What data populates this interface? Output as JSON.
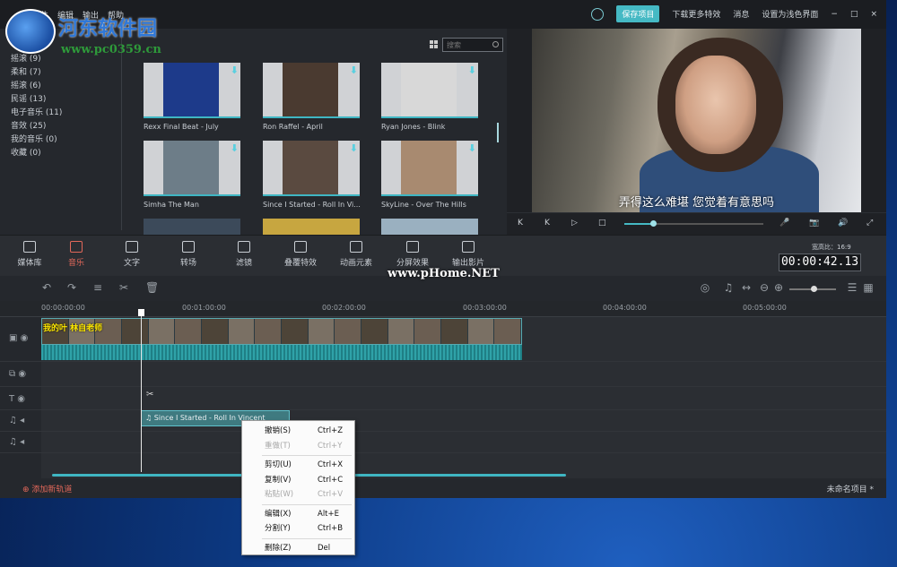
{
  "titlebar": {
    "menu": [
      "文件",
      "编辑",
      "输出",
      "帮助"
    ],
    "save_project": "保存项目",
    "download_effects": "下载更多特效",
    "messages": "消息",
    "set_light": "设置为浅色界面",
    "window_controls": [
      "−",
      "□",
      "×"
    ]
  },
  "library": {
    "categories": [
      "摇滚 (9)",
      "柔和 (7)",
      "摇滚 (6)",
      "民谣 (13)",
      "电子音乐 (11)",
      "音效 (25)",
      "我的音乐 (0)",
      "收藏 (0)"
    ],
    "search_placeholder": "搜索",
    "tiles": [
      {
        "caption": "Rexx Final Beat - July",
        "color": "#1d3a8a"
      },
      {
        "caption": "Ron Raffel - April",
        "color": "#4a3a30"
      },
      {
        "caption": "Ryan Jones - Blink",
        "color": "#d8d8d8"
      },
      {
        "caption": "Simha The Man",
        "color": "#6d7d88"
      },
      {
        "caption": "Since I Started - Roll In Vi...",
        "color": "#5a4a40"
      },
      {
        "caption": "SkyLine - Over The Hills",
        "color": "#a88a70"
      }
    ]
  },
  "preview": {
    "subtitle": "弄得这么难堪 您觉着有意思吗",
    "controls": [
      "K",
      "K",
      "▷",
      "□",
      "🎤",
      "📷",
      "🔊",
      "⤢"
    ]
  },
  "tools": [
    {
      "label": "媒体库",
      "active": false
    },
    {
      "label": "音乐",
      "active": true
    },
    {
      "label": "文字",
      "active": false
    },
    {
      "label": "转场",
      "active": false
    },
    {
      "label": "滤镜",
      "active": false
    },
    {
      "label": "叠覆特效",
      "active": false
    },
    {
      "label": "动画元素",
      "active": false
    },
    {
      "label": "分屏效果",
      "active": false
    },
    {
      "label": "输出影片",
      "active": false
    }
  ],
  "aspect_ratio": "宽高比：16:9",
  "timecode": "00:00:42.13",
  "timeline": {
    "ruler": [
      "00:00:00:00",
      "00:01:00:00",
      "00:02:00:00",
      "00:03:00:00",
      "00:04:00:00",
      "00:05:00:00"
    ],
    "video_clip_text": "我的叶 林自老师",
    "audio_clip": "Since I Started - Roll In Vincent",
    "add_track": "添加新轨道",
    "project_name": "未命名项目 *"
  },
  "context_menu": [
    {
      "label": "撤销(S)",
      "shortcut": "Ctrl+Z",
      "disabled": false
    },
    {
      "label": "重做(T)",
      "shortcut": "Ctrl+Y",
      "disabled": true
    },
    {
      "label": "剪切(U)",
      "shortcut": "Ctrl+X",
      "disabled": false
    },
    {
      "label": "复制(V)",
      "shortcut": "Ctrl+C",
      "disabled": false
    },
    {
      "label": "粘贴(W)",
      "shortcut": "Ctrl+V",
      "disabled": true
    },
    {
      "label": "编辑(X)",
      "shortcut": "Alt+E",
      "disabled": false
    },
    {
      "label": "分割(Y)",
      "shortcut": "Ctrl+B",
      "disabled": false
    },
    {
      "label": "删除(Z)",
      "shortcut": "Del",
      "disabled": false
    }
  ],
  "watermarks": {
    "site_name": "河东软件园",
    "site_url": "www.pc0359.cn",
    "phome": "www.pHome.NET"
  }
}
